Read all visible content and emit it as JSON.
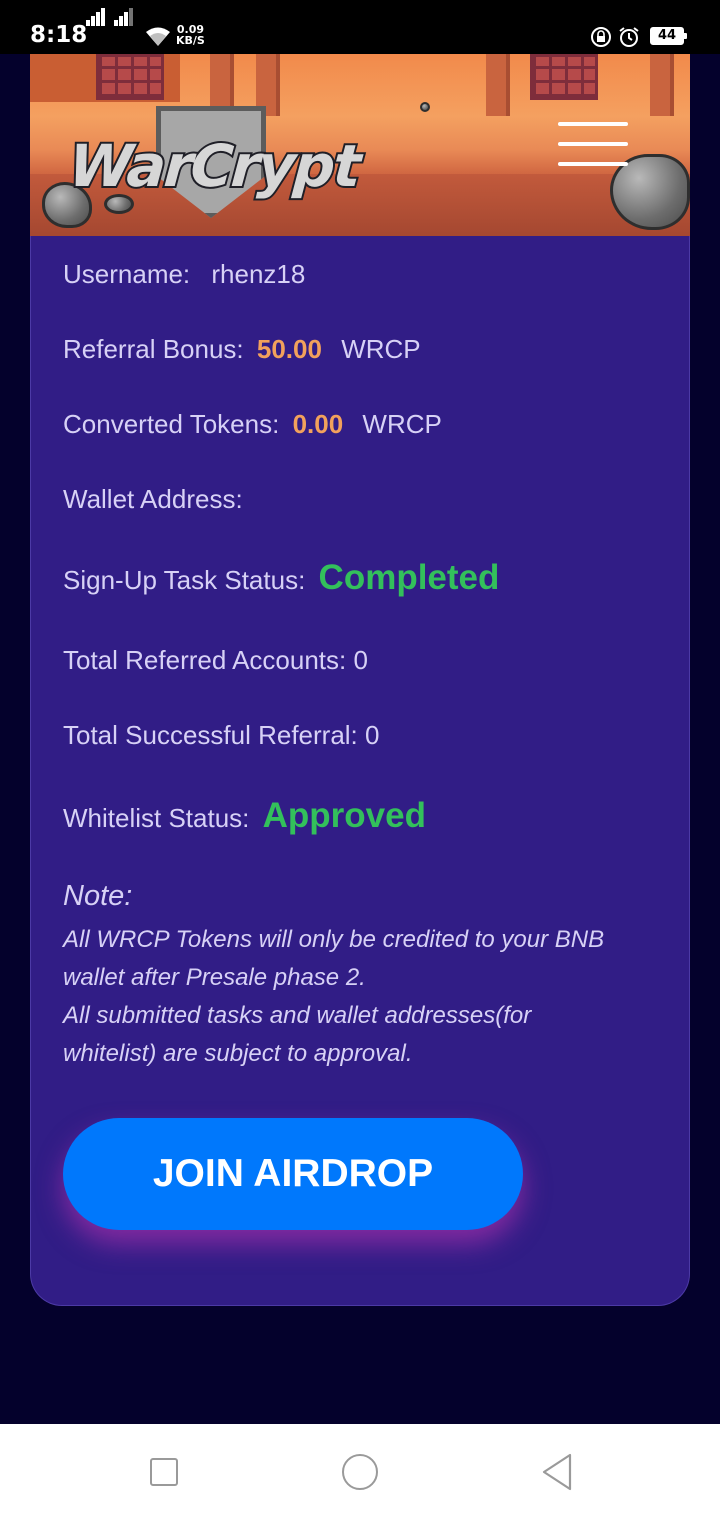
{
  "status_bar": {
    "time": "8:18",
    "net_speed_value": "0.09",
    "net_speed_unit": "KB/S",
    "battery": "44",
    "icons": [
      "signal-icon",
      "signal-icon",
      "wifi-icon",
      "lock-rotation-icon",
      "alarm-icon",
      "battery-icon"
    ]
  },
  "header": {
    "logo_text": "WarCrypt",
    "menu_icon": "hamburger-menu-icon"
  },
  "profile": {
    "username_label": "Username:",
    "username_value": "rhenz18",
    "referral_bonus_label": "Referral Bonus:",
    "referral_bonus_amount": "50.00",
    "referral_bonus_unit": "WRCP",
    "converted_tokens_label": "Converted Tokens:",
    "converted_tokens_amount": "0.00",
    "converted_tokens_unit": "WRCP",
    "wallet_address_label": "Wallet Address:",
    "wallet_address_value": "",
    "signup_task_label": "Sign-Up Task Status:",
    "signup_task_status": "Completed",
    "total_referred_label": "Total Referred Accounts:",
    "total_referred_value": "0",
    "total_successful_label": "Total Successful Referral:",
    "total_successful_value": "0",
    "whitelist_label": "Whitelist Status:",
    "whitelist_status": "Approved"
  },
  "note": {
    "title": "Note:",
    "lines": [
      "All WRCP Tokens will only be credited to your BNB",
      "wallet after Presale phase 2.",
      "All submitted tasks and wallet addresses(for",
      "whitelist) are subject to approval."
    ]
  },
  "actions": {
    "join_airdrop_label": "JOIN AIRDROP"
  },
  "colors": {
    "card_background": "#311d86",
    "page_background": "#04012c",
    "amount_color": "#f2a15c",
    "status_ok_color": "#33c05b",
    "button_color": "#0078fc"
  },
  "nav_bar": {
    "icons": [
      "recent-apps-icon",
      "home-icon",
      "back-icon"
    ]
  }
}
